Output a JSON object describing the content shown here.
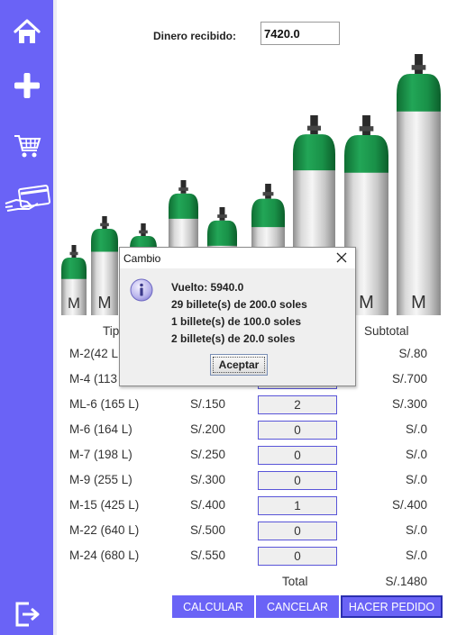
{
  "sidebar": {
    "items": [
      {
        "icon": "home-icon"
      },
      {
        "icon": "plus-icon"
      },
      {
        "icon": "cart-icon"
      },
      {
        "icon": "card-payment-icon"
      },
      {
        "icon": "logout-icon"
      }
    ]
  },
  "payment": {
    "label": "Dinero recibido:",
    "value": "7420.0"
  },
  "cylinders": {
    "labels": [
      "M",
      "M",
      "M",
      "M"
    ]
  },
  "table": {
    "headers": {
      "type": "Tip",
      "subtotal": "Subtotal"
    },
    "rows": [
      {
        "type": "M-2(42 L",
        "price": "",
        "qty": "",
        "subtotal": "S/.80"
      },
      {
        "type": "M-4 (113",
        "price": "",
        "qty": "",
        "subtotal": "S/.700"
      },
      {
        "type": "ML-6 (165 L)",
        "price": "S/.150",
        "qty": "2",
        "subtotal": "S/.300"
      },
      {
        "type": "M-6 (164 L)",
        "price": "S/.200",
        "qty": "0",
        "subtotal": "S/.0"
      },
      {
        "type": "M-7 (198 L)",
        "price": "S/.250",
        "qty": "0",
        "subtotal": "S/.0"
      },
      {
        "type": "M-9 (255 L)",
        "price": "S/.300",
        "qty": "0",
        "subtotal": "S/.0"
      },
      {
        "type": "M-15 (425 L)",
        "price": "S/.400",
        "qty": "1",
        "subtotal": "S/.400"
      },
      {
        "type": "M-22 (640 L)",
        "price": "S/.500",
        "qty": "0",
        "subtotal": "S/.0"
      },
      {
        "type": "M-24 (680 L)",
        "price": "S/.550",
        "qty": "0",
        "subtotal": "S/.0"
      }
    ],
    "total_label": "Total",
    "total_value": "S/.1480"
  },
  "buttons": {
    "calcular": "CALCULAR",
    "cancelar": "CANCELAR",
    "hacer_pedido": "HACER PEDIDO"
  },
  "dialog": {
    "title": "Cambio",
    "lines": [
      "Vuelto: 5940.0",
      "29 billete(s) de 200.0 soles",
      "1 billete(s) de 100.0 soles",
      "2 billete(s) de 20.0 soles"
    ],
    "ok_label": "Aceptar",
    "icon": "info-icon"
  },
  "colors": {
    "sidebar": "#6a63f6",
    "cylinder_cap": "#1e9a4e",
    "input_border": "#5955d8"
  }
}
